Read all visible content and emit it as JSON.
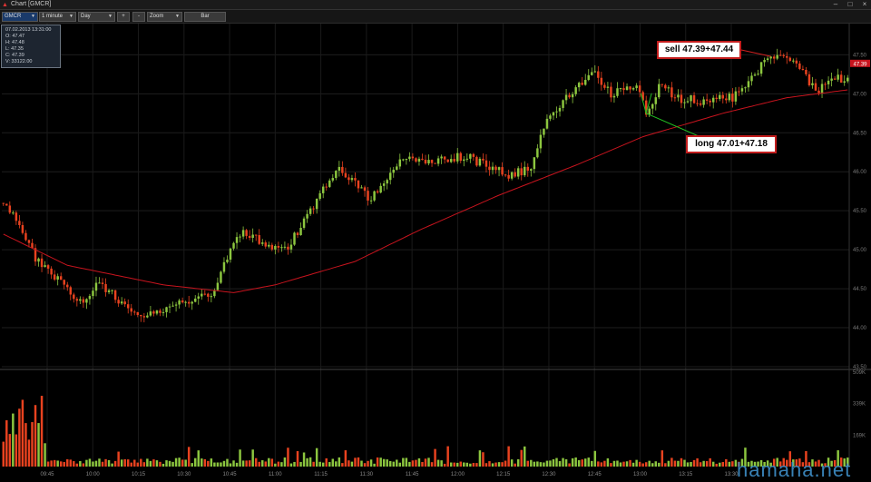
{
  "window": {
    "title": "Chart [GMCR]",
    "min": "–",
    "max": "□",
    "close": "×"
  },
  "toolbar": {
    "symbol": "GMCR",
    "interval": "1 minute",
    "range": "Day",
    "plus": "+",
    "minus": "-",
    "zoom": "Zoom",
    "style": "Bar"
  },
  "info": {
    "date": "07.02.2013 13:31:00",
    "open": "O: 47.47",
    "high": "H: 47.48",
    "low": "L: 47.35",
    "close": "C: 47.39",
    "volume": "V: 33122.00"
  },
  "annotations": {
    "sell": "sell 47.39+47.44",
    "long": "long 47.01+47.18"
  },
  "watermark": "hamaha.net",
  "colors": {
    "up": "#8cc63f",
    "down": "#e8421f",
    "ma": "#c8141e",
    "price_tag": "#c8141e"
  },
  "chart_data": {
    "type": "candlestick",
    "price_axis": {
      "ticks": [
        "47.50",
        "47.00",
        "46.50",
        "46.00",
        "45.50",
        "45.00",
        "44.50",
        "44.00",
        "43.50"
      ],
      "ylim": [
        43.5,
        47.9
      ]
    },
    "volume_axis": {
      "ticks": [
        "509K",
        "339K",
        "169K"
      ],
      "ylim": [
        0,
        509
      ]
    },
    "time_axis": {
      "ticks": [
        "09:45",
        "10:00",
        "10:15",
        "10:30",
        "10:45",
        "11:00",
        "11:15",
        "11:30",
        "11:45",
        "12:00",
        "12:15",
        "12:30",
        "12:45",
        "13:00",
        "13:15",
        "13:30"
      ]
    },
    "last_price": "47.39",
    "anchors": [
      [
        0,
        45.6
      ],
      [
        5,
        45.3
      ],
      [
        10,
        44.9
      ],
      [
        20,
        44.5
      ],
      [
        25,
        44.3
      ],
      [
        30,
        44.6
      ],
      [
        37,
        44.3
      ],
      [
        45,
        44.15
      ],
      [
        55,
        44.3
      ],
      [
        65,
        44.45
      ],
      [
        70,
        44.9
      ],
      [
        75,
        45.25
      ],
      [
        82,
        45.05
      ],
      [
        88,
        45.0
      ],
      [
        95,
        45.4
      ],
      [
        100,
        45.8
      ],
      [
        105,
        46.05
      ],
      [
        110,
        45.85
      ],
      [
        115,
        45.65
      ],
      [
        120,
        45.9
      ],
      [
        125,
        46.2
      ],
      [
        135,
        46.15
      ],
      [
        145,
        46.2
      ],
      [
        152,
        46.05
      ],
      [
        158,
        45.95
      ],
      [
        165,
        46.05
      ],
      [
        170,
        46.7
      ],
      [
        175,
        46.9
      ],
      [
        180,
        47.1
      ],
      [
        185,
        47.25
      ],
      [
        190,
        47.0
      ],
      [
        198,
        47.1
      ],
      [
        201,
        46.75
      ],
      [
        206,
        47.15
      ],
      [
        210,
        46.95
      ],
      [
        220,
        46.9
      ],
      [
        228,
        46.95
      ],
      [
        235,
        47.25
      ],
      [
        240,
        47.5
      ],
      [
        247,
        47.4
      ],
      [
        252,
        47.15
      ],
      [
        255,
        47.05
      ],
      [
        260,
        47.2
      ],
      [
        264,
        47.15
      ]
    ],
    "ma_anchors": [
      [
        0,
        45.2
      ],
      [
        20,
        44.8
      ],
      [
        50,
        44.55
      ],
      [
        72,
        44.45
      ],
      [
        85,
        44.55
      ],
      [
        110,
        44.85
      ],
      [
        130,
        45.25
      ],
      [
        155,
        45.7
      ],
      [
        180,
        46.1
      ],
      [
        200,
        46.45
      ],
      [
        225,
        46.75
      ],
      [
        245,
        46.95
      ],
      [
        264,
        47.05
      ]
    ]
  }
}
